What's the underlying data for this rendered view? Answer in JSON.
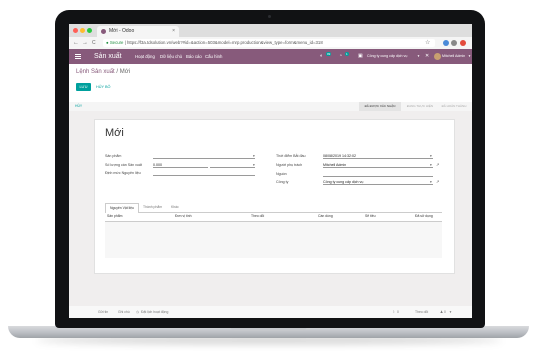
{
  "browser": {
    "tab_title": "Mới - Odoo",
    "tab_close": "×",
    "secure_label": "Secure",
    "url": "https://f3a.tdsolution.vn/web?#id=&action=503&model=mrp.production&view_type=form&menu_id=318",
    "nav_back": "←",
    "nav_forward": "→",
    "nav_reload": "C",
    "star": "☆"
  },
  "odoo": {
    "app_title": "Sản xuất",
    "top_menu": [
      "Hoạt động",
      "Dữ liệu chủ",
      "Báo cáo",
      "Cấu hình"
    ],
    "chat_count": "99",
    "activity_count": "1",
    "company": "Công ty cung cấp dịch vụ",
    "user": "Mitchell Admin",
    "close_x": "✕"
  },
  "control_panel": {
    "breadcrumb_parent": "Lệnh Sản xuất",
    "breadcrumb_sep": " / ",
    "breadcrumb_current": "Mới",
    "save_label": "LƯU",
    "discard_label": "HỦY BỎ"
  },
  "statusbar": {
    "action": "HỦY",
    "stages": [
      "ĐÃ ĐƯỢC XÁC NHẬN",
      "ĐANG THỰC HIỆN",
      "ĐÃ HOÀN THÀNH"
    ]
  },
  "form": {
    "title": "Mới",
    "left_fields": [
      {
        "label": "Sản phẩm",
        "value": ""
      },
      {
        "label": "Số lượng cần Sản xuất",
        "value": "0.000"
      },
      {
        "label": "Định mức Nguyên liệu",
        "value": ""
      }
    ],
    "right_fields": [
      {
        "label": "Thời điểm Bắt đầu",
        "value": "08/08/2019 14:32:02"
      },
      {
        "label": "Người phụ trách",
        "value": "Mitchell Admin"
      },
      {
        "label": "Nguồn",
        "value": ""
      },
      {
        "label": "Công ty",
        "value": "Công ty cung cấp dịch vụ"
      }
    ],
    "tabs": [
      "Nguyên Vật liệu",
      "Thành phẩm",
      "Khác"
    ],
    "columns": [
      "Sản phẩm",
      "Đơn vị tính",
      "Theo dõi",
      "Cần dùng",
      "Sẽ tiêu",
      "Đã sử dụng"
    ]
  },
  "chatter": {
    "send_message": "Gửi tin",
    "log_note": "Ghi chú",
    "schedule_activity": "Đặt lịch hoạt động",
    "attachments": "0",
    "follow": "Theo dõi",
    "followers": "0"
  },
  "colors": {
    "brand": "#875a7b",
    "primary_button": "#00a09d"
  }
}
